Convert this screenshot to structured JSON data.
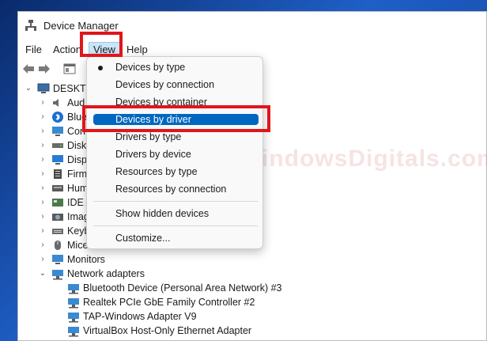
{
  "window": {
    "title": "Device Manager"
  },
  "menubar": {
    "file": "File",
    "action": "Action",
    "view": "View",
    "help": "Help"
  },
  "tree": {
    "root": "DESKTOP",
    "categories": [
      "Aud",
      "Blue",
      "Con",
      "Disk",
      "Disp",
      "Firm",
      "Hum",
      "IDE A",
      "Imag",
      "Keyb",
      "Mice",
      "Monitors"
    ],
    "network": {
      "label": "Network adapters",
      "children": [
        "Bluetooth Device (Personal Area Network) #3",
        "Realtek PCIe GbE Family Controller #2",
        "TAP-Windows Adapter V9",
        "VirtualBox Host-Only Ethernet Adapter"
      ]
    }
  },
  "view_menu": {
    "items": [
      "Devices by type",
      "Devices by connection",
      "Devices by container",
      "Devices by driver",
      "Drivers by type",
      "Drivers by device",
      "Resources by type",
      "Resources by connection",
      "Show hidden devices",
      "Customize..."
    ],
    "checked_index": 0,
    "highlighted_index": 3
  },
  "watermark": {
    "text": "WindowsDigitals.com"
  },
  "colors": {
    "highlight": "#0067c0",
    "annotation": "#e0161a",
    "menu_active": "#cce4f7"
  }
}
